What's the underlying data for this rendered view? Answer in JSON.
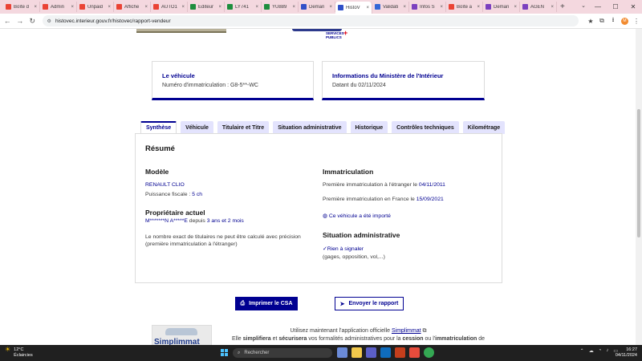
{
  "browser": {
    "tabs": [
      {
        "label": "Boîte d",
        "color": "#ea4335"
      },
      {
        "label": "Admin",
        "color": "#ea4335"
      },
      {
        "label": "Unpaid",
        "color": "#ea4335"
      },
      {
        "label": "Affiche",
        "color": "#ea4335"
      },
      {
        "label": "AUTO1",
        "color": "#ea4335"
      },
      {
        "label": "Editeur",
        "color": "#1e8e3e"
      },
      {
        "label": "LY741",
        "color": "#1e8e3e"
      },
      {
        "label": "YU889",
        "color": "#1e8e3e"
      },
      {
        "label": "Deman",
        "color": "#3050c8"
      },
      {
        "label": "HistoV",
        "color": "#3050c8"
      },
      {
        "label": "Validati",
        "color": "#3367d6"
      },
      {
        "label": "Infos S",
        "color": "#7b3fbf"
      },
      {
        "label": "Boîte a",
        "color": "#ea4335"
      },
      {
        "label": "Deman",
        "color": "#7b3fbf"
      },
      {
        "label": "AGEN",
        "color": "#7b3fbf"
      }
    ],
    "url": "histovec.interieur.gouv.fr/histovec/rapport-vendeur",
    "profile_initial": "M"
  },
  "header": {
    "sp_logo_line1": "SERVICES",
    "sp_logo_line2": "PUBLICS"
  },
  "cards": {
    "vehicle": {
      "title": "Le véhicule",
      "value": "Numéro d'immatriculation : G8-5**-WC"
    },
    "ministry": {
      "title": "Informations du Ministère de l'Intérieur",
      "value": "Datant du 02/11/2024"
    }
  },
  "tabs": [
    "Synthèse",
    "Véhicule",
    "Titulaire et Titre",
    "Situation administrative",
    "Historique",
    "Contrôles techniques",
    "Kilométrage"
  ],
  "summary": {
    "title": "Résumé",
    "model": {
      "heading": "Modèle",
      "name": "RENAULT CLIO",
      "fiscal_label": "Puissance fiscale : ",
      "fiscal_value": "5 ch"
    },
    "owner": {
      "heading": "Propriétaire actuel",
      "name": "M*******N A*****E",
      "since_label": " depuis ",
      "since_value": "3 ans et 2 mois",
      "note_line1": "Le nombre exact de titulaires ne peut être calculé avec précision",
      "note_line2": "(première immatriculation à l'étranger)"
    },
    "registration": {
      "heading": "Immatriculation",
      "foreign_label": "Première immatriculation à l'étranger le ",
      "foreign_date": "04/11/2011",
      "france_label": "Première immatriculation en France le ",
      "france_date": "15/09/2021",
      "imported": "Ce véhicule a été importé"
    },
    "admin": {
      "heading": "Situation administrative",
      "status": "Rien à signaler",
      "detail": "(gages, opposition, vol,...)"
    }
  },
  "actions": {
    "print": "Imprimer le CSA",
    "send": "Envoyer le rapport"
  },
  "promo": {
    "brand": "Simplimmat",
    "line1_prefix": "Utilisez maintenant l'application officielle ",
    "line1_link": "Simplimmat",
    "line2_a": "Elle ",
    "line2_b": "simplifiera",
    "line2_c": " et ",
    "line2_d": "sécurisera",
    "line2_e": " vos formalités administratives pour la ",
    "line2_f": "cession",
    "line2_g": " ou l'",
    "line2_h": "immatriculation",
    "line2_i": " de"
  },
  "taskbar": {
    "temp": "12°C",
    "weather": "Éclaircies",
    "search": "Rechercher",
    "time": "16:27",
    "date": "04/11/2024"
  }
}
